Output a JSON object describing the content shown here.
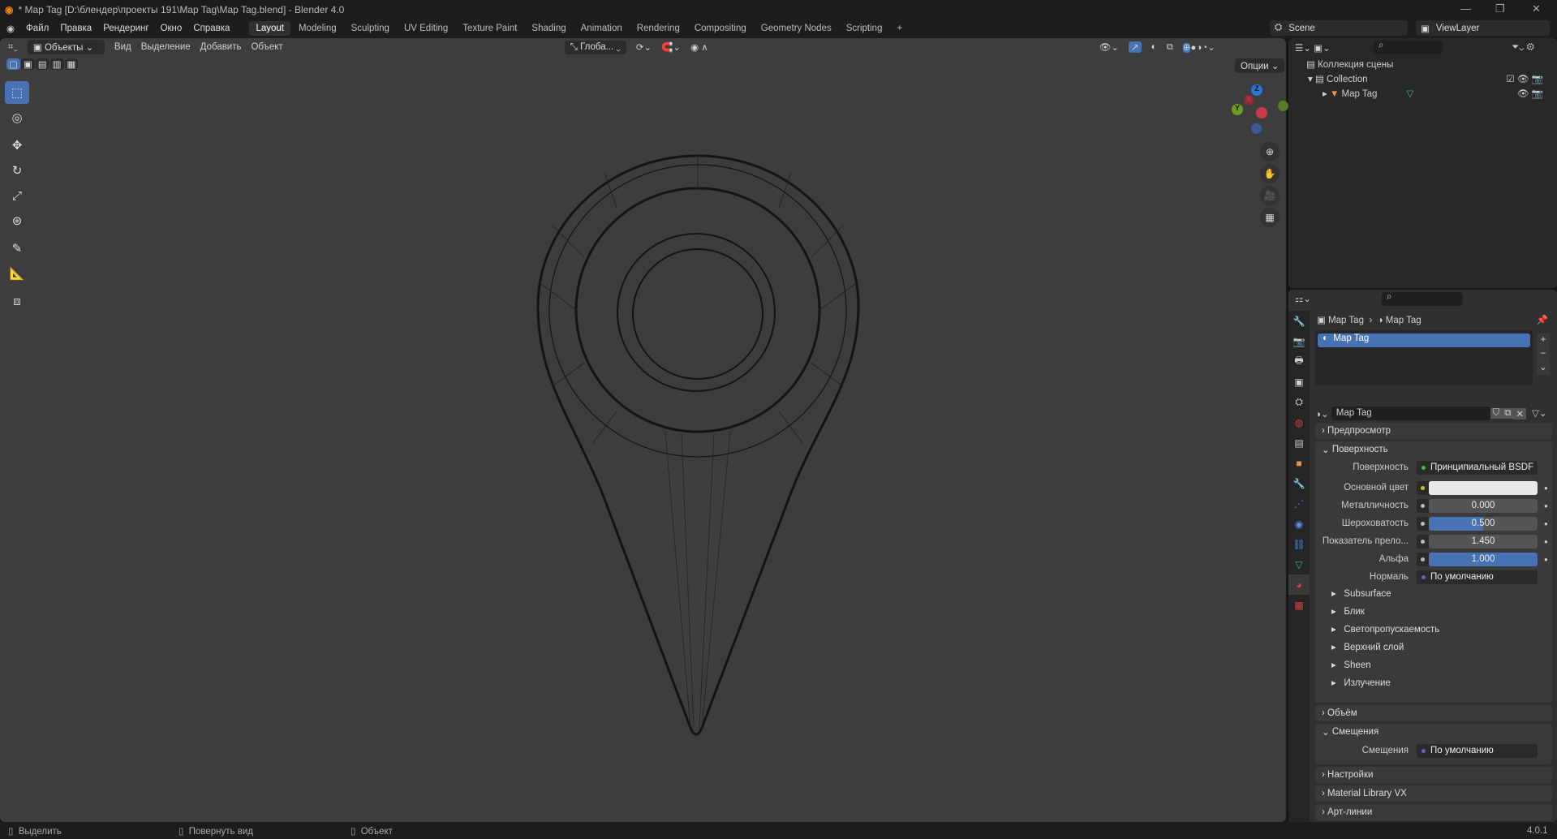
{
  "window": {
    "title": "* Map Tag [D:\\блендер\\проекты 191\\Map Tag\\Map Tag.blend] - Blender 4.0"
  },
  "menu": [
    "Файл",
    "Правка",
    "Рендеринг",
    "Окно",
    "Справка"
  ],
  "workspaces": [
    "Layout",
    "Modeling",
    "Sculpting",
    "UV Editing",
    "Texture Paint",
    "Shading",
    "Animation",
    "Rendering",
    "Compositing",
    "Geometry Nodes",
    "Scripting"
  ],
  "scene": "Scene",
  "view_layer": "ViewLayer",
  "viewport": {
    "mode": "Объекты",
    "menus": [
      "Вид",
      "Выделение",
      "Добавить",
      "Объект"
    ],
    "transform": "Глоба...",
    "options": "Опции",
    "gizmo": {
      "x": "X",
      "y": "Y",
      "z": "Z"
    }
  },
  "outliner": {
    "root": "Коллекция сцены",
    "collection": "Collection",
    "object": "Map Tag"
  },
  "properties": {
    "breadcrumb": [
      "Map Tag",
      "Map Tag"
    ],
    "slot": "Map Tag",
    "material": "Map Tag",
    "preview": "Предпросмотр",
    "surface_panel": "Поверхность",
    "surface": {
      "label": "Поверхность",
      "value": "Принципиальный BSDF"
    },
    "fields": [
      {
        "label": "Основной цвет",
        "type": "color",
        "color": "#e8e8e8"
      },
      {
        "label": "Металличность",
        "value": "0.000",
        "fraction": 0
      },
      {
        "label": "Шероховатость",
        "value": "0.500",
        "fraction": 0.5
      },
      {
        "label": "Показатель прело...",
        "value": "1.450",
        "fraction": 0
      },
      {
        "label": "Альфа",
        "value": "1.000",
        "fraction": 1
      }
    ],
    "normal": {
      "label": "Нормаль",
      "value": "По умолчанию"
    },
    "subpanels": [
      "Subsurface",
      "Блик",
      "Светопропускаемость",
      "Верхний слой",
      "Sheen",
      "Излучение"
    ],
    "volume": "Объём",
    "displacement_panel": "Смещения",
    "displacement": {
      "label": "Смещения",
      "value": "По умолчанию"
    },
    "more_panels": [
      "Настройки",
      "Material Library VX",
      "Арт-линии"
    ]
  },
  "status": {
    "select": "Выделить",
    "rotate": "Повернуть вид",
    "object": "Объект",
    "version": "4.0.1"
  }
}
